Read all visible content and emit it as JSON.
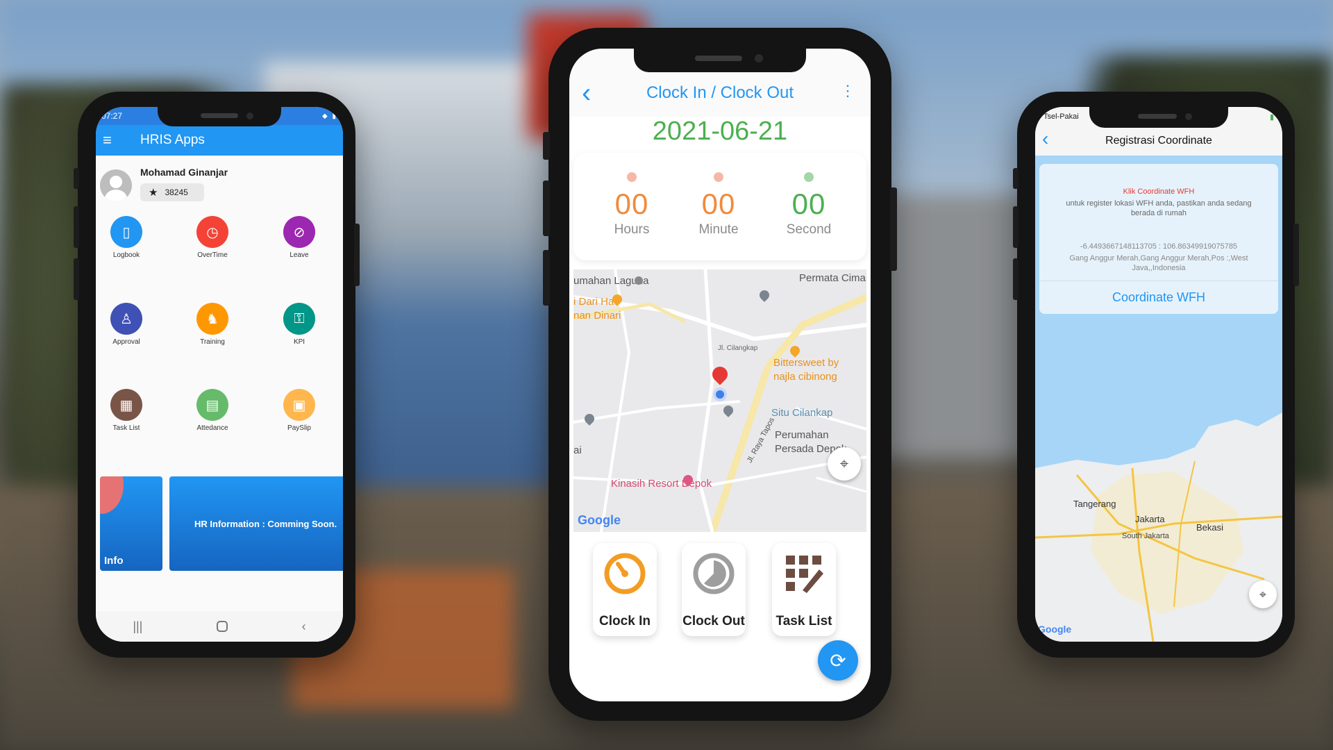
{
  "phone_left": {
    "status": {
      "time": "07:27"
    },
    "appbar": {
      "title": "HRIS Apps"
    },
    "user": {
      "name": "Mohamad Ginanjar",
      "points": "38245"
    },
    "menu": [
      {
        "label": "Logbook",
        "color": "#2196f3",
        "icon": "logbook-icon"
      },
      {
        "label": "OverTime",
        "color": "#f44336",
        "icon": "clock-icon"
      },
      {
        "label": "Leave",
        "color": "#9c27b0",
        "icon": "leave-icon"
      },
      {
        "label": "Approval",
        "color": "#3f51b5",
        "icon": "stamp-icon"
      },
      {
        "label": "Training",
        "color": "#ff9800",
        "icon": "training-icon"
      },
      {
        "label": "KPI",
        "color": "#009688",
        "icon": "key-icon"
      },
      {
        "label": "Task List",
        "color": "#795548",
        "icon": "tasklist-icon"
      },
      {
        "label": "Attedance",
        "color": "#66bb6a",
        "icon": "calendar-icon"
      },
      {
        "label": "PaySlip",
        "color": "#ffb74d",
        "icon": "payslip-icon"
      }
    ],
    "banner": {
      "info_label": "Info",
      "text": "HR Information : Comming Soon."
    }
  },
  "phone_center": {
    "header": {
      "title": "Clock In / Clock Out"
    },
    "date": "2021-06-21",
    "timer": [
      {
        "value": "00",
        "unit": "Hours",
        "color": "#f08a3c",
        "dot": "#f5b8a8"
      },
      {
        "value": "00",
        "unit": "Minute",
        "color": "#f08a3c",
        "dot": "#f5b8a8"
      },
      {
        "value": "00",
        "unit": "Second",
        "color": "#4caf50",
        "dot": "#a5d6a7"
      }
    ],
    "map": {
      "labels": [
        "umahan Laguna",
        "Permata Cimang",
        "i Dari Hati",
        "nan Dinari",
        "Jl. Cilangkap",
        "Bittersweet by",
        "najla cibinong",
        "Situ Cilankap",
        "Jl. Raya Tapos",
        "Perumahan",
        "Persada Depok",
        "ai",
        "Kinasih Resort Depok"
      ],
      "brand": "Google"
    },
    "actions": [
      {
        "label": "Clock In",
        "icon": "clock-in-icon"
      },
      {
        "label": "Clock Out",
        "icon": "clock-out-icon"
      },
      {
        "label": "Task List",
        "icon": "task-list-icon"
      }
    ]
  },
  "phone_right": {
    "status": {
      "carrier": "Tsel-Pakai"
    },
    "header": {
      "title": "Registrasi Coordinate"
    },
    "card": {
      "heading": "Klik Coordinate WFH",
      "desc": "untuk register lokasi WFH anda, pastikan anda sedang berada di rumah",
      "coords": "-6.4493667148113705 : 106.86349919075785",
      "address": "Gang Anggur Merah,Gang Anggur Merah,Pos :,West Java,,Indonesia",
      "button": "Coordinate WFH"
    },
    "map": {
      "labels": [
        "Tangerang",
        "Jakarta",
        "Bekasi",
        "South Jakarta"
      ],
      "brand": "Google"
    }
  }
}
